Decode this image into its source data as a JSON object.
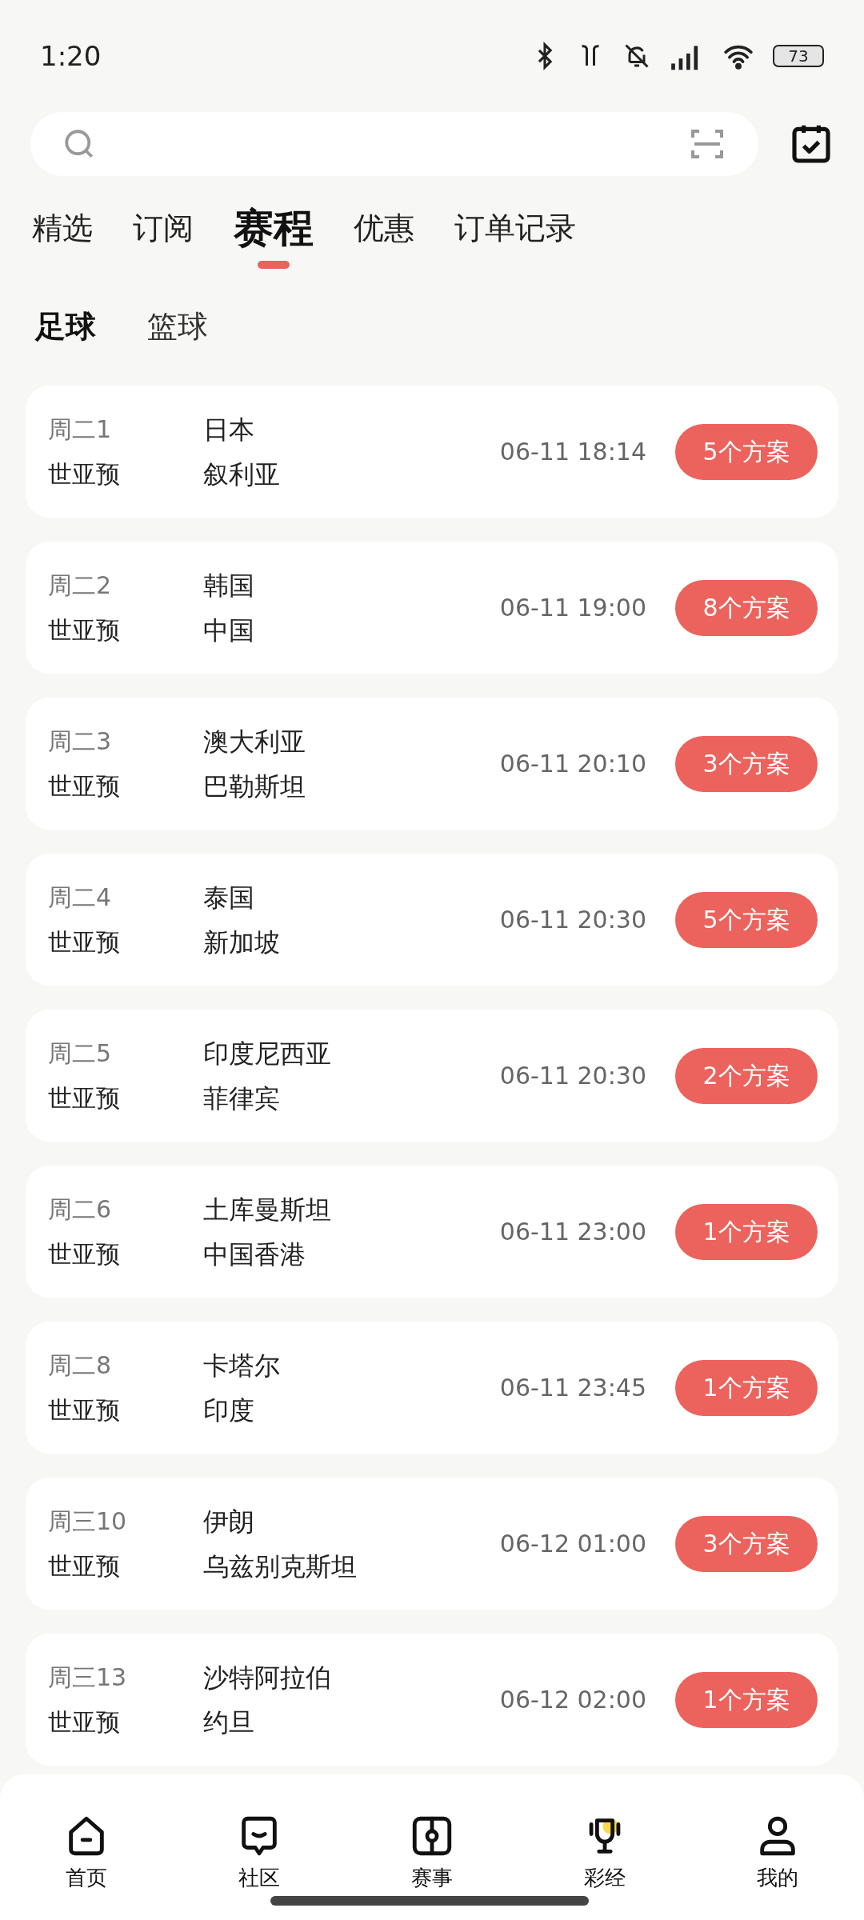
{
  "status_bar": {
    "time": "1:20",
    "battery": "73"
  },
  "top_tabs": [
    {
      "label": "精选",
      "selected": false
    },
    {
      "label": "订阅",
      "selected": false
    },
    {
      "label": "赛程",
      "selected": true
    },
    {
      "label": "优惠",
      "selected": false
    },
    {
      "label": "订单记录",
      "selected": false
    }
  ],
  "sport_tabs": [
    {
      "label": "足球",
      "selected": true
    },
    {
      "label": "篮球",
      "selected": false
    }
  ],
  "matches": [
    {
      "code": "周二1",
      "league": "世亚预",
      "home": "日本",
      "away": "叙利亚",
      "time": "06-11 18:14",
      "plans": "5个方案"
    },
    {
      "code": "周二2",
      "league": "世亚预",
      "home": "韩国",
      "away": "中国",
      "time": "06-11 19:00",
      "plans": "8个方案"
    },
    {
      "code": "周二3",
      "league": "世亚预",
      "home": "澳大利亚",
      "away": "巴勒斯坦",
      "time": "06-11 20:10",
      "plans": "3个方案"
    },
    {
      "code": "周二4",
      "league": "世亚预",
      "home": "泰国",
      "away": "新加坡",
      "time": "06-11 20:30",
      "plans": "5个方案"
    },
    {
      "code": "周二5",
      "league": "世亚预",
      "home": "印度尼西亚",
      "away": "菲律宾",
      "time": "06-11 20:30",
      "plans": "2个方案"
    },
    {
      "code": "周二6",
      "league": "世亚预",
      "home": "土库曼斯坦",
      "away": "中国香港",
      "time": "06-11 23:00",
      "plans": "1个方案"
    },
    {
      "code": "周二8",
      "league": "世亚预",
      "home": "卡塔尔",
      "away": "印度",
      "time": "06-11 23:45",
      "plans": "1个方案"
    },
    {
      "code": "周三10",
      "league": "世亚预",
      "home": "伊朗",
      "away": "乌兹别克斯坦",
      "time": "06-12 01:00",
      "plans": "3个方案"
    },
    {
      "code": "周三13",
      "league": "世亚预",
      "home": "沙特阿拉伯",
      "away": "约旦",
      "time": "06-12 02:00",
      "plans": "1个方案"
    }
  ],
  "bottom_nav": [
    {
      "label": "首页",
      "kind": "home"
    },
    {
      "label": "社区",
      "kind": "chat"
    },
    {
      "label": "赛事",
      "kind": "match"
    },
    {
      "label": "彩经",
      "kind": "trophy"
    },
    {
      "label": "我的",
      "kind": "user"
    }
  ]
}
